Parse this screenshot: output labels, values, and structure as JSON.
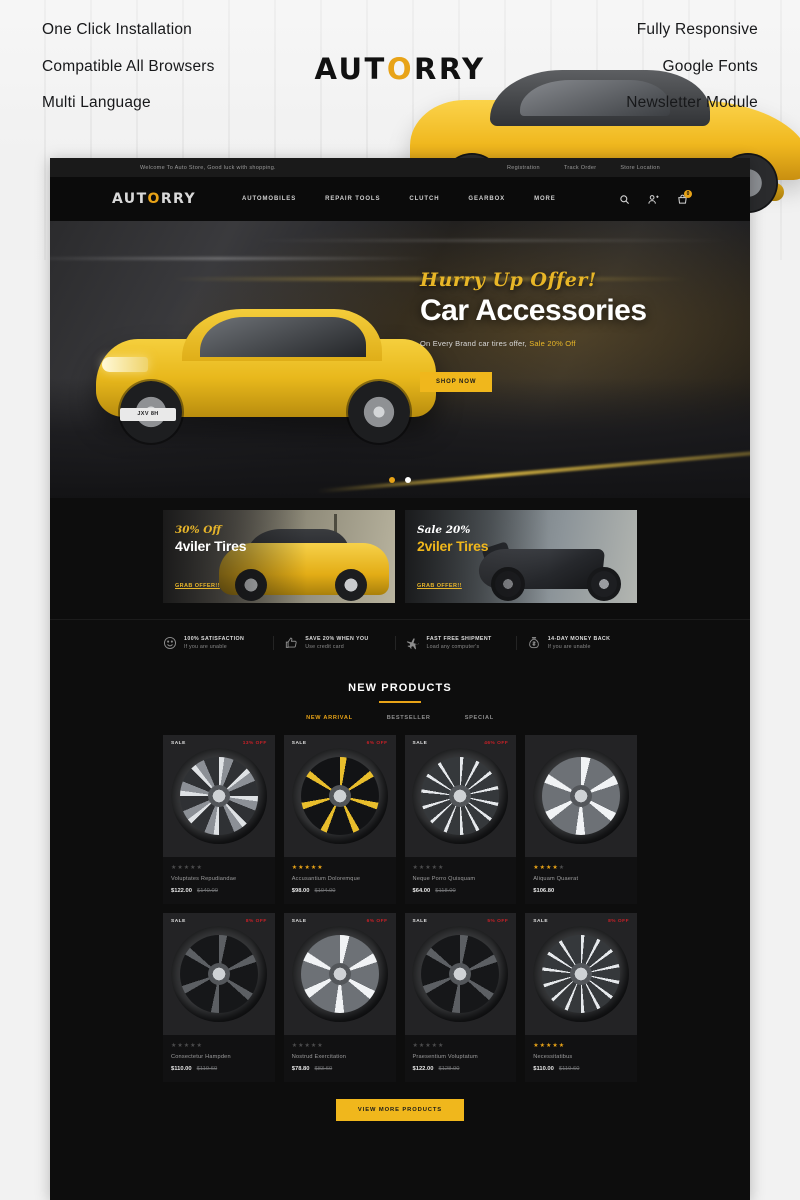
{
  "promo": {
    "left_features": [
      "One Click Installation",
      "Compatible All Browsers",
      "Multi Language"
    ],
    "right_features": [
      "Fully Responsive",
      "Google Fonts",
      "Newsletter Module"
    ],
    "logo_pre": "AUT",
    "logo_accent": "O",
    "logo_post": "RRY"
  },
  "site": {
    "topbar": {
      "welcome": "Welcome To Auto Store, Good luck with shopping.",
      "links": [
        "Registration",
        "Track Order",
        "Store Location"
      ]
    },
    "nav": {
      "logo_pre": "AUT",
      "logo_accent": "O",
      "logo_post": "RRY",
      "menu": [
        "AUTOMOBILES",
        "REPAIR TOOLS",
        "CLUTCH",
        "GEARBOX",
        "MORE"
      ],
      "cart_count": "0",
      "icons": [
        "search-icon",
        "user-add-icon",
        "cart-icon"
      ]
    },
    "hero": {
      "kicker": "Hurry Up Offer!",
      "title": "Car Accessories",
      "subtitle_plain": "On Every Brand car tires offer, ",
      "subtitle_accent": "Sale 20% Off",
      "cta": "SHOP NOW",
      "plate": "JXV 8H",
      "slides": 2,
      "active_slide": 1
    },
    "promo_cards": [
      {
        "kicker": "30% Off",
        "title": "4viler Tires",
        "link": "GRAB OFFER!!"
      },
      {
        "kicker": "Sale 20%",
        "title": "2viler Tires",
        "link": "GRAB OFFER!!"
      }
    ],
    "services": [
      {
        "icon": "smiley-icon",
        "title": "100% SATISFACTION",
        "sub": "If you are unable"
      },
      {
        "icon": "thumbs-up-icon",
        "title": "SAVE 20% WHEN YOU",
        "sub": "Use credit card"
      },
      {
        "icon": "plane-icon",
        "title": "FAST FREE SHIPMENT",
        "sub": "Load any computer's"
      },
      {
        "icon": "money-bag-icon",
        "title": "14-DAY MONEY BACK",
        "sub": "If you are unable"
      }
    ],
    "products_section": {
      "heading": "NEW PRODUCTS",
      "tabs": [
        {
          "label": "NEW ARRIVAL",
          "active": true
        },
        {
          "label": "BESTSELLER",
          "active": false
        },
        {
          "label": "SPECIAL",
          "active": false
        }
      ],
      "view_more": "VIEW MORE PRODUCTS"
    },
    "products": [
      {
        "sale": "SALE",
        "off": "13% OFF",
        "name": "Voluptates Repudiandae",
        "price": "$122.00",
        "old_price": "$140.00",
        "rating": 5,
        "stars_on": false,
        "rim": ""
      },
      {
        "sale": "SALE",
        "off": "6% OFF",
        "name": "Accusantium Doloremque",
        "price": "$98.00",
        "old_price": "$104.00",
        "rating": 5,
        "stars_on": true,
        "rim": "gold"
      },
      {
        "sale": "SALE",
        "off": "46% OFF",
        "name": "Neque Porro Quisquam",
        "price": "$64.00",
        "old_price": "$118.00",
        "rating": 5,
        "stars_on": false,
        "rim": "spoke"
      },
      {
        "sale": "",
        "off": "",
        "name": "Aliquam Quaerat",
        "price": "$106.80",
        "old_price": "",
        "rating": 4,
        "stars_on": true,
        "rim": "chrome"
      },
      {
        "sale": "SALE",
        "off": "8% OFF",
        "name": "Consectetur Hampden",
        "price": "$110.00",
        "old_price": "$119.60",
        "rating": 5,
        "stars_on": false,
        "rim": "dark"
      },
      {
        "sale": "SALE",
        "off": "6% OFF",
        "name": "Nostrud Exercitation",
        "price": "$78.80",
        "old_price": "$83.60",
        "rating": 5,
        "stars_on": false,
        "rim": "chrome"
      },
      {
        "sale": "SALE",
        "off": "5% OFF",
        "name": "Praesentium Voluptatum",
        "price": "$122.00",
        "old_price": "$128.00",
        "rating": 5,
        "stars_on": false,
        "rim": "dark"
      },
      {
        "sale": "SALE",
        "off": "8% OFF",
        "name": "Necessitatibus",
        "price": "$110.00",
        "old_price": "$119.60",
        "rating": 5,
        "stars_on": true,
        "rim": "spoke"
      }
    ]
  },
  "colors": {
    "accent": "#e8a317",
    "cta": "#f0b71c",
    "sale_red": "#cc2027",
    "dark_bg": "#0d0d0d"
  }
}
